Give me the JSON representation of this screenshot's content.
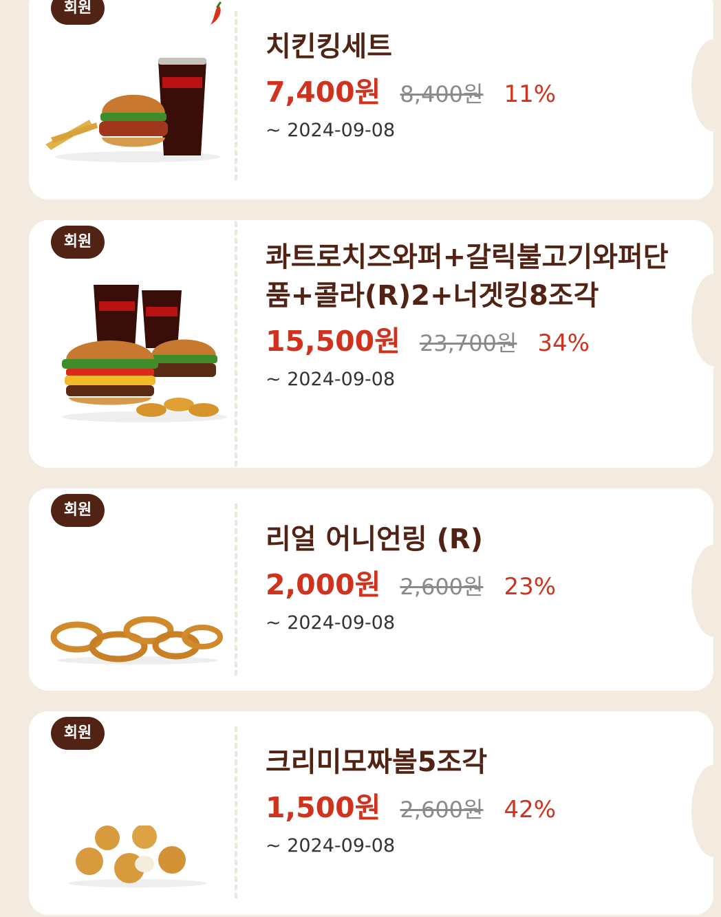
{
  "badge_label": "회원",
  "colors": {
    "brand_brown": "#502314",
    "price_red": "#d1321d",
    "background": "#f3ebdf"
  },
  "coupons": [
    {
      "name": "치킨킹세트",
      "price": "7,400원",
      "original_price": "8,400원",
      "discount": "11%",
      "expiry": "~ 2024-09-08",
      "spicy_icon": "chili-pepper-icon",
      "image": "chicken-king-set-illustration"
    },
    {
      "name": "콰트로치즈와퍼+갈릭불고기와퍼단품+콜라(R)2+너겟킹8조각",
      "price": "15,500원",
      "original_price": "23,700원",
      "discount": "34%",
      "expiry": "~ 2024-09-08",
      "image": "whopper-bundle-illustration"
    },
    {
      "name": "리얼 어니언링 (R)",
      "price": "2,000원",
      "original_price": "2,600원",
      "discount": "23%",
      "expiry": "~ 2024-09-08",
      "image": "onion-rings-illustration"
    },
    {
      "name": "크리미모짜볼5조각",
      "price": "1,500원",
      "original_price": "2,600원",
      "discount": "42%",
      "expiry": "~ 2024-09-08",
      "image": "mozzarella-balls-illustration"
    }
  ]
}
